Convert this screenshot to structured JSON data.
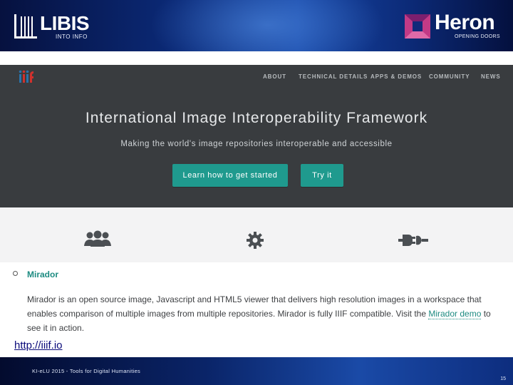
{
  "banner": {
    "libis_name": "LIBIS",
    "libis_tagline": "INTO INFO",
    "heron_name": "Heron",
    "heron_tagline": "OPENING DOORS"
  },
  "iiif_site": {
    "logo": "iiif",
    "nav": [
      "ABOUT",
      "TECHNICAL DETAILS",
      "APPS & DEMOS",
      "COMMUNITY",
      "NEWS"
    ],
    "title": "International Image Interoperability Framework",
    "subtitle": "Making the world's image repositories interoperable and accessible",
    "primary_button": "Learn how to get started",
    "secondary_button": "Try it",
    "feature_icons": [
      "community-icon",
      "gear-icon",
      "plug-icon"
    ],
    "accent_color": "#1f9a8e"
  },
  "section": {
    "bullet_title": "Mirador",
    "description_line1": "Mirador is an open source image, Javascript and HTML5 viewer that delivers high resolution images in a workspace that",
    "description_line2_pre": "enables comparison of multiple images from multiple repositories. Mirador is fully IIIF compatible. Visit the ",
    "demo_link": "Mirador demo",
    "description_line2_post": " to",
    "description_line3": "see it in action."
  },
  "url": "http://iiif.io",
  "footer": {
    "text": "KI-eLU 2015 - Tools for Digital Humanities",
    "page_number": "15"
  }
}
